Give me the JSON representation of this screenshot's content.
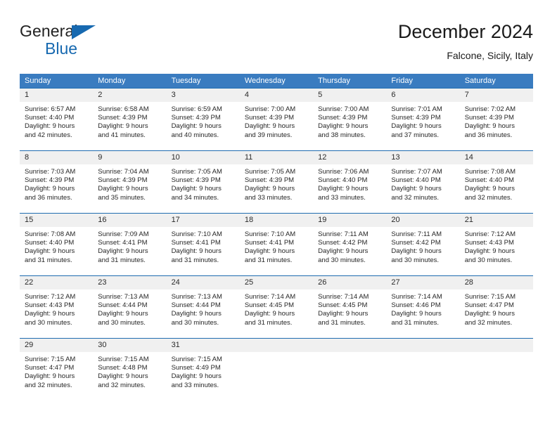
{
  "brand": {
    "name_part1": "General",
    "name_part2": "Blue",
    "flag_icon": "triangle-flag-icon",
    "accent_color": "#1769b0"
  },
  "header": {
    "title": "December 2024",
    "subtitle": "Falcone, Sicily, Italy"
  },
  "calendar": {
    "header_bg_color": "#3a7cc0",
    "row_border_color": "#1f6cb0",
    "day_band_color": "#f0f0f0",
    "weekdays": [
      "Sunday",
      "Monday",
      "Tuesday",
      "Wednesday",
      "Thursday",
      "Friday",
      "Saturday"
    ],
    "weeks": [
      [
        {
          "day": "1",
          "sunrise": "Sunrise: 6:57 AM",
          "sunset": "Sunset: 4:40 PM",
          "daylight_line1": "Daylight: 9 hours",
          "daylight_line2": "and 42 minutes."
        },
        {
          "day": "2",
          "sunrise": "Sunrise: 6:58 AM",
          "sunset": "Sunset: 4:39 PM",
          "daylight_line1": "Daylight: 9 hours",
          "daylight_line2": "and 41 minutes."
        },
        {
          "day": "3",
          "sunrise": "Sunrise: 6:59 AM",
          "sunset": "Sunset: 4:39 PM",
          "daylight_line1": "Daylight: 9 hours",
          "daylight_line2": "and 40 minutes."
        },
        {
          "day": "4",
          "sunrise": "Sunrise: 7:00 AM",
          "sunset": "Sunset: 4:39 PM",
          "daylight_line1": "Daylight: 9 hours",
          "daylight_line2": "and 39 minutes."
        },
        {
          "day": "5",
          "sunrise": "Sunrise: 7:00 AM",
          "sunset": "Sunset: 4:39 PM",
          "daylight_line1": "Daylight: 9 hours",
          "daylight_line2": "and 38 minutes."
        },
        {
          "day": "6",
          "sunrise": "Sunrise: 7:01 AM",
          "sunset": "Sunset: 4:39 PM",
          "daylight_line1": "Daylight: 9 hours",
          "daylight_line2": "and 37 minutes."
        },
        {
          "day": "7",
          "sunrise": "Sunrise: 7:02 AM",
          "sunset": "Sunset: 4:39 PM",
          "daylight_line1": "Daylight: 9 hours",
          "daylight_line2": "and 36 minutes."
        }
      ],
      [
        {
          "day": "8",
          "sunrise": "Sunrise: 7:03 AM",
          "sunset": "Sunset: 4:39 PM",
          "daylight_line1": "Daylight: 9 hours",
          "daylight_line2": "and 36 minutes."
        },
        {
          "day": "9",
          "sunrise": "Sunrise: 7:04 AM",
          "sunset": "Sunset: 4:39 PM",
          "daylight_line1": "Daylight: 9 hours",
          "daylight_line2": "and 35 minutes."
        },
        {
          "day": "10",
          "sunrise": "Sunrise: 7:05 AM",
          "sunset": "Sunset: 4:39 PM",
          "daylight_line1": "Daylight: 9 hours",
          "daylight_line2": "and 34 minutes."
        },
        {
          "day": "11",
          "sunrise": "Sunrise: 7:05 AM",
          "sunset": "Sunset: 4:39 PM",
          "daylight_line1": "Daylight: 9 hours",
          "daylight_line2": "and 33 minutes."
        },
        {
          "day": "12",
          "sunrise": "Sunrise: 7:06 AM",
          "sunset": "Sunset: 4:40 PM",
          "daylight_line1": "Daylight: 9 hours",
          "daylight_line2": "and 33 minutes."
        },
        {
          "day": "13",
          "sunrise": "Sunrise: 7:07 AM",
          "sunset": "Sunset: 4:40 PM",
          "daylight_line1": "Daylight: 9 hours",
          "daylight_line2": "and 32 minutes."
        },
        {
          "day": "14",
          "sunrise": "Sunrise: 7:08 AM",
          "sunset": "Sunset: 4:40 PM",
          "daylight_line1": "Daylight: 9 hours",
          "daylight_line2": "and 32 minutes."
        }
      ],
      [
        {
          "day": "15",
          "sunrise": "Sunrise: 7:08 AM",
          "sunset": "Sunset: 4:40 PM",
          "daylight_line1": "Daylight: 9 hours",
          "daylight_line2": "and 31 minutes."
        },
        {
          "day": "16",
          "sunrise": "Sunrise: 7:09 AM",
          "sunset": "Sunset: 4:41 PM",
          "daylight_line1": "Daylight: 9 hours",
          "daylight_line2": "and 31 minutes."
        },
        {
          "day": "17",
          "sunrise": "Sunrise: 7:10 AM",
          "sunset": "Sunset: 4:41 PM",
          "daylight_line1": "Daylight: 9 hours",
          "daylight_line2": "and 31 minutes."
        },
        {
          "day": "18",
          "sunrise": "Sunrise: 7:10 AM",
          "sunset": "Sunset: 4:41 PM",
          "daylight_line1": "Daylight: 9 hours",
          "daylight_line2": "and 31 minutes."
        },
        {
          "day": "19",
          "sunrise": "Sunrise: 7:11 AM",
          "sunset": "Sunset: 4:42 PM",
          "daylight_line1": "Daylight: 9 hours",
          "daylight_line2": "and 30 minutes."
        },
        {
          "day": "20",
          "sunrise": "Sunrise: 7:11 AM",
          "sunset": "Sunset: 4:42 PM",
          "daylight_line1": "Daylight: 9 hours",
          "daylight_line2": "and 30 minutes."
        },
        {
          "day": "21",
          "sunrise": "Sunrise: 7:12 AM",
          "sunset": "Sunset: 4:43 PM",
          "daylight_line1": "Daylight: 9 hours",
          "daylight_line2": "and 30 minutes."
        }
      ],
      [
        {
          "day": "22",
          "sunrise": "Sunrise: 7:12 AM",
          "sunset": "Sunset: 4:43 PM",
          "daylight_line1": "Daylight: 9 hours",
          "daylight_line2": "and 30 minutes."
        },
        {
          "day": "23",
          "sunrise": "Sunrise: 7:13 AM",
          "sunset": "Sunset: 4:44 PM",
          "daylight_line1": "Daylight: 9 hours",
          "daylight_line2": "and 30 minutes."
        },
        {
          "day": "24",
          "sunrise": "Sunrise: 7:13 AM",
          "sunset": "Sunset: 4:44 PM",
          "daylight_line1": "Daylight: 9 hours",
          "daylight_line2": "and 30 minutes."
        },
        {
          "day": "25",
          "sunrise": "Sunrise: 7:14 AM",
          "sunset": "Sunset: 4:45 PM",
          "daylight_line1": "Daylight: 9 hours",
          "daylight_line2": "and 31 minutes."
        },
        {
          "day": "26",
          "sunrise": "Sunrise: 7:14 AM",
          "sunset": "Sunset: 4:45 PM",
          "daylight_line1": "Daylight: 9 hours",
          "daylight_line2": "and 31 minutes."
        },
        {
          "day": "27",
          "sunrise": "Sunrise: 7:14 AM",
          "sunset": "Sunset: 4:46 PM",
          "daylight_line1": "Daylight: 9 hours",
          "daylight_line2": "and 31 minutes."
        },
        {
          "day": "28",
          "sunrise": "Sunrise: 7:15 AM",
          "sunset": "Sunset: 4:47 PM",
          "daylight_line1": "Daylight: 9 hours",
          "daylight_line2": "and 32 minutes."
        }
      ],
      [
        {
          "day": "29",
          "sunrise": "Sunrise: 7:15 AM",
          "sunset": "Sunset: 4:47 PM",
          "daylight_line1": "Daylight: 9 hours",
          "daylight_line2": "and 32 minutes."
        },
        {
          "day": "30",
          "sunrise": "Sunrise: 7:15 AM",
          "sunset": "Sunset: 4:48 PM",
          "daylight_line1": "Daylight: 9 hours",
          "daylight_line2": "and 32 minutes."
        },
        {
          "day": "31",
          "sunrise": "Sunrise: 7:15 AM",
          "sunset": "Sunset: 4:49 PM",
          "daylight_line1": "Daylight: 9 hours",
          "daylight_line2": "and 33 minutes."
        },
        {
          "day": "",
          "sunrise": "",
          "sunset": "",
          "daylight_line1": "",
          "daylight_line2": ""
        },
        {
          "day": "",
          "sunrise": "",
          "sunset": "",
          "daylight_line1": "",
          "daylight_line2": ""
        },
        {
          "day": "",
          "sunrise": "",
          "sunset": "",
          "daylight_line1": "",
          "daylight_line2": ""
        },
        {
          "day": "",
          "sunrise": "",
          "sunset": "",
          "daylight_line1": "",
          "daylight_line2": ""
        }
      ]
    ]
  }
}
